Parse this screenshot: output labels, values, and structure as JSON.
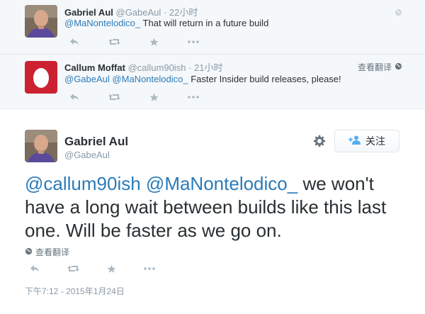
{
  "replies": [
    {
      "name": "Gabriel Aul",
      "handle": "@GabeAul",
      "time": "22小时",
      "mentions": [
        "@MaNontelodico_"
      ],
      "text": "That will return in a future build",
      "avatar": "gabriel-photo"
    },
    {
      "name": "Callum Moffat",
      "handle": "@callum90ish",
      "time": "21小时",
      "mentions": [
        "@GabeAul",
        "@MaNontelodico_"
      ],
      "text": "Faster Insider build releases, please!",
      "translate_label": "查看翻译",
      "avatar": "red-egg"
    }
  ],
  "main": {
    "name": "Gabriel Aul",
    "handle": "@GabeAul",
    "follow_label": "关注",
    "mention1": "@callum90ish",
    "mention2": "@MaNontelodico_",
    "text": "we won't have a long wait between builds like this last one. Will be faster as we go on.",
    "translate_label": "查看翻译",
    "timestamp": "下午7:12 - 2015年1月24日"
  },
  "colors": {
    "link": "#2b7bb9",
    "muted": "#8899a6",
    "reply_bg": "#f5f8fa",
    "egg_bg": "#cc2131"
  },
  "icons": [
    "reply-icon",
    "retweet-icon",
    "favorite-icon",
    "more-icon",
    "globe-icon",
    "gear-icon",
    "follow-person-icon"
  ]
}
